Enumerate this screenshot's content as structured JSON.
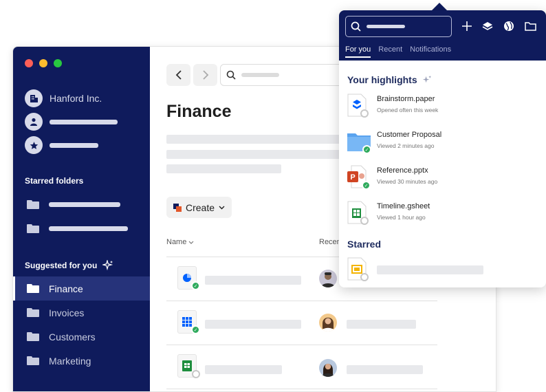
{
  "sidebar": {
    "account_name": "Hanford Inc.",
    "starred_heading": "Starred folders",
    "suggested_heading": "Suggested for you",
    "items": [
      {
        "label": "Finance",
        "active": true
      },
      {
        "label": "Invoices",
        "active": false
      },
      {
        "label": "Customers",
        "active": false
      },
      {
        "label": "Marketing",
        "active": false
      }
    ]
  },
  "main": {
    "title": "Finance",
    "create_label": "Create",
    "columns": {
      "name": "Name",
      "recent": "Recen"
    }
  },
  "popup": {
    "tabs": [
      {
        "label": "For you",
        "active": true
      },
      {
        "label": "Recent",
        "active": false
      },
      {
        "label": "Notifications",
        "active": false
      }
    ],
    "highlights_heading": "Your highlights",
    "highlights": [
      {
        "title": "Brainstorm.paper",
        "subtitle": "Opened often this week",
        "icon": "paper-doc-icon"
      },
      {
        "title": "Customer Proposal",
        "subtitle": "Viewed 2 minutes ago",
        "icon": "folder-icon"
      },
      {
        "title": "Reference.pptx",
        "subtitle": "Viewed 30 minutes ago",
        "icon": "powerpoint-icon"
      },
      {
        "title": "Timeline.gsheet",
        "subtitle": "Viewed 1 hour ago",
        "icon": "gsheet-icon"
      }
    ],
    "starred_heading": "Starred"
  },
  "colors": {
    "sidebar_bg": "#0f1b5c",
    "accent_blue": "#0061fe",
    "success_green": "#2eaa5c"
  }
}
